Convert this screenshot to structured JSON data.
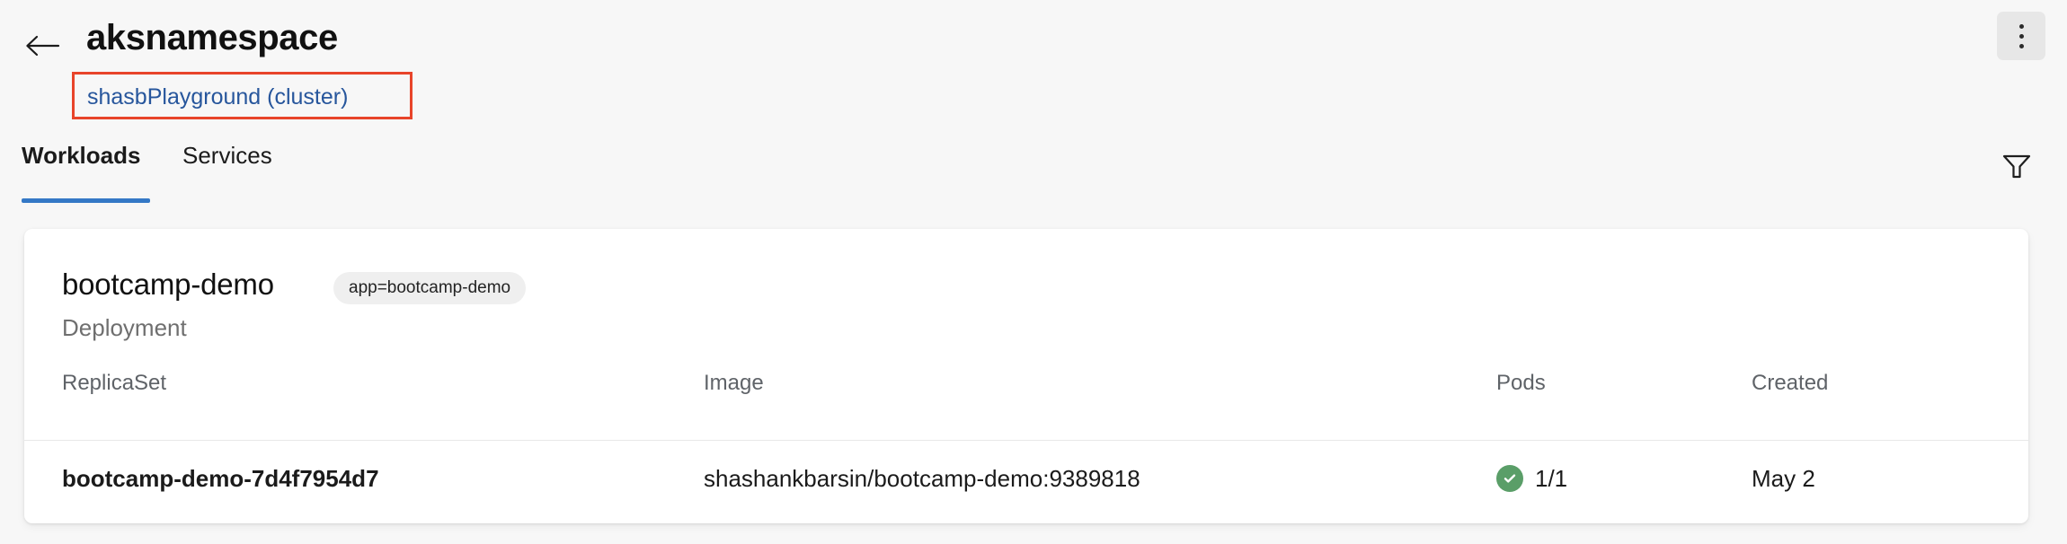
{
  "header": {
    "back_icon": "arrow-left-icon",
    "title": "aksnamespace",
    "cluster_link": "shasbPlayground (cluster)",
    "overflow_icon": "more-vertical-icon",
    "annotation_color": "#e8442a",
    "link_color": "#27569c"
  },
  "tabs": [
    {
      "label": "Workloads",
      "active": true
    },
    {
      "label": "Services",
      "active": false
    }
  ],
  "toolbar": {
    "filter_icon": "filter-funnel-icon"
  },
  "card": {
    "title": "bootcamp-demo",
    "label_badge": "app=bootcamp-demo",
    "kind": "Deployment",
    "columns": [
      "ReplicaSet",
      "Image",
      "Pods",
      "Created"
    ],
    "rows": [
      {
        "replicaset": "bootcamp-demo-7d4f7954d7",
        "image": "shashankbarsin/bootcamp-demo:9389818",
        "pods": "1/1",
        "pods_status": "healthy",
        "pods_status_icon": "check-circle-icon",
        "pods_status_color": "#5a9e68",
        "created": "May 2"
      }
    ]
  },
  "theme": {
    "background": "#f7f7f7",
    "card_background": "#ffffff",
    "accent": "#3478c6",
    "muted_text": "#5f6368"
  }
}
